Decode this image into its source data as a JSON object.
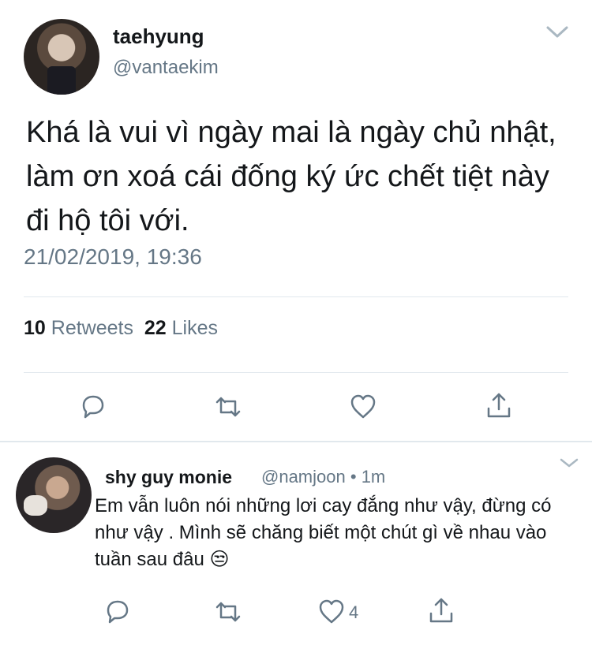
{
  "tweet": {
    "author_name": "taehyung",
    "author_handle": "@vantaekim",
    "text": "Khá là vui vì ngày mai là ngày chủ nhật, làm ơn xoá cái đống ký ức chết tiệt này đi hộ tôi với.",
    "timestamp": "21/02/2019, 19:36",
    "retweet_count": "10",
    "retweet_label": "Retweets",
    "like_count": "22",
    "like_label": "Likes",
    "icons": [
      "chevron-down-icon",
      "reply-icon",
      "retweet-icon",
      "like-icon",
      "share-icon"
    ]
  },
  "reply": {
    "author_name": "shy guy monie",
    "author_handle": "@namjoon",
    "separator": "•",
    "time": "1m",
    "text": "Em vẫn luôn nói những lơi cay đắng như vậy, đừng có như vậy . Mình sẽ chăng biết một chút gì về nhau vào tuần sau đâu 😒",
    "like_count": "4"
  },
  "colors": {
    "primary_text": "#14171a",
    "secondary_text": "#657786",
    "divider": "#e1e8ed"
  }
}
